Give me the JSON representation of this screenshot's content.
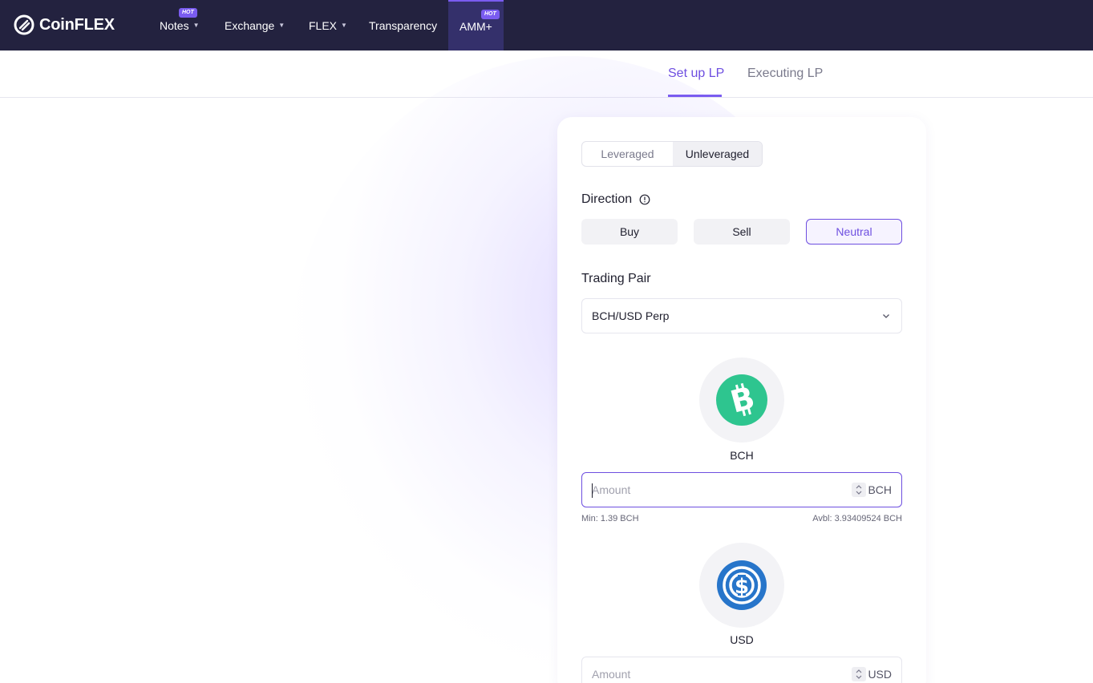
{
  "brand": {
    "name": "CoinFLEX"
  },
  "nav": {
    "items": [
      {
        "label": "Notes",
        "badge": "HOT",
        "has_dropdown": true
      },
      {
        "label": "Exchange",
        "has_dropdown": true
      },
      {
        "label": "FLEX",
        "has_dropdown": true
      },
      {
        "label": "Transparency",
        "has_dropdown": false
      },
      {
        "label": "AMM+",
        "badge": "HOT",
        "has_dropdown": false,
        "active": true
      }
    ]
  },
  "tabs": [
    {
      "label": "Set up LP",
      "active": true
    },
    {
      "label": "Executing LP",
      "active": false
    }
  ],
  "mode_toggle": {
    "options": [
      "Leveraged",
      "Unleveraged"
    ],
    "selected": "Unleveraged"
  },
  "direction": {
    "label": "Direction",
    "icon": "info-icon",
    "options": [
      "Buy",
      "Sell",
      "Neutral"
    ],
    "selected": "Neutral"
  },
  "trading_pair": {
    "label": "Trading Pair",
    "value": "BCH/USD Perp"
  },
  "base_asset": {
    "symbol": "BCH",
    "icon": "bitcoin-cash-icon",
    "color": "#2ec58f",
    "input_placeholder": "Amount",
    "unit": "BCH",
    "min_text": "Min: 1.39 BCH",
    "available_text": "Avbl: 3.93409524 BCH"
  },
  "quote_asset": {
    "symbol": "USD",
    "icon": "usdc-icon",
    "color": "#2775ca",
    "input_placeholder": "Amount",
    "unit": "USD"
  },
  "colors": {
    "nav_bg": "#23223f",
    "accent": "#6e4fe0"
  }
}
